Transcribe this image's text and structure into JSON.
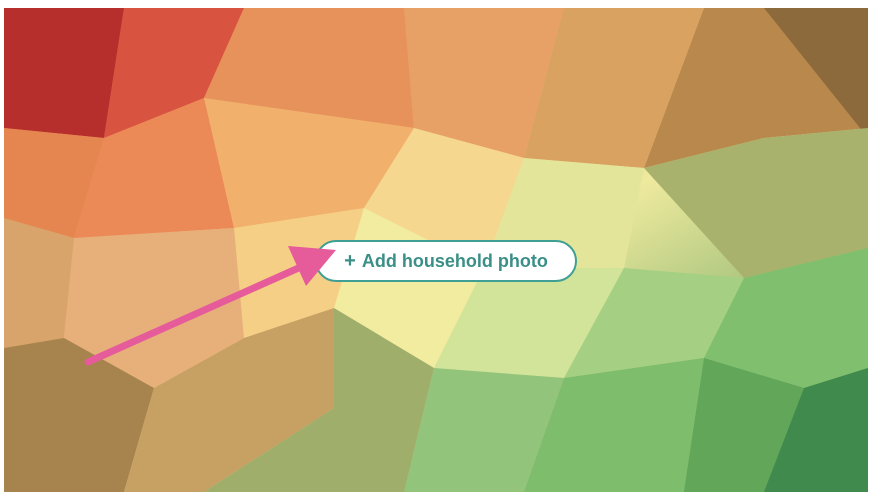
{
  "cover_photo": {
    "add_button": {
      "icon": "plus-icon",
      "label": "Add household photo"
    }
  },
  "annotation": {
    "arrow_color": "#e65b9a"
  }
}
